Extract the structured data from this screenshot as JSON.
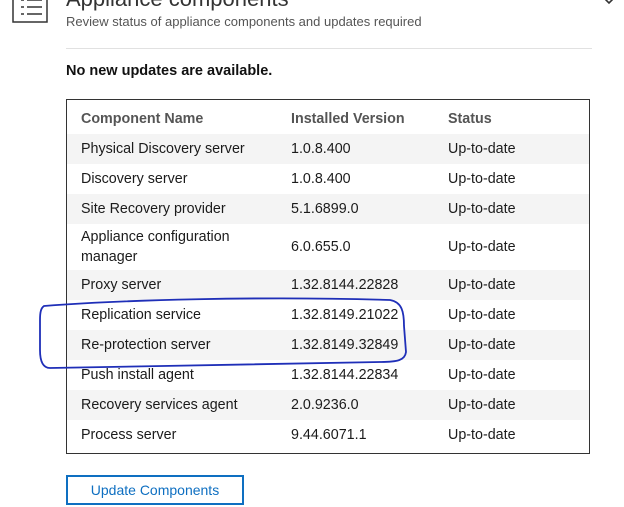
{
  "header": {
    "title": "Appliance components",
    "subtitle": "Review status of appliance components and updates required",
    "icon": "list-check-icon",
    "expand_icon": "chevron-down-icon"
  },
  "status_message": "No new updates are available.",
  "table": {
    "columns": [
      "Component Name",
      "Installed Version",
      "Status"
    ],
    "rows": [
      {
        "name": "Physical Discovery server",
        "version": "1.0.8.400",
        "status": "Up-to-date"
      },
      {
        "name": "Discovery server",
        "version": "1.0.8.400",
        "status": "Up-to-date"
      },
      {
        "name": "Site Recovery provider",
        "version": "5.1.6899.0",
        "status": "Up-to-date"
      },
      {
        "name": "Appliance configuration manager",
        "version": "6.0.655.0",
        "status": "Up-to-date"
      },
      {
        "name": "Proxy server",
        "version": "1.32.8144.22828",
        "status": "Up-to-date"
      },
      {
        "name": "Replication service",
        "version": "1.32.8149.21022",
        "status": "Up-to-date"
      },
      {
        "name": "Re-protection server",
        "version": "1.32.8149.32849",
        "status": "Up-to-date"
      },
      {
        "name": "Push install agent",
        "version": "1.32.8144.22834",
        "status": "Up-to-date"
      },
      {
        "name": "Recovery services agent",
        "version": "2.0.9236.0",
        "status": "Up-to-date"
      },
      {
        "name": "Process server",
        "version": "9.44.6071.1",
        "status": "Up-to-date"
      }
    ]
  },
  "actions": {
    "update_label": "Update Components"
  },
  "colors": {
    "accent": "#0e6fc1",
    "annotation": "#1f2fb8"
  }
}
